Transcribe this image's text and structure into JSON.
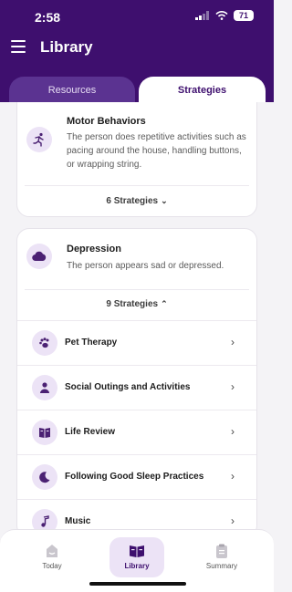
{
  "status_bar": {
    "time": "2:58",
    "battery": "71"
  },
  "header": {
    "title": "Library"
  },
  "tabs": [
    {
      "label": "Resources",
      "active": false
    },
    {
      "label": "Strategies",
      "active": true
    }
  ],
  "cards": {
    "motor": {
      "title": "Motor Behaviors",
      "description": "The person does repetitive activities such as pacing around the house, handling buttons, or wrapping string.",
      "strategies_label": "6 Strategies",
      "expanded": false
    },
    "depression": {
      "title": "Depression",
      "description": "The person appears sad or depressed.",
      "strategies_label": "9 Strategies",
      "expanded": true,
      "strategies": [
        {
          "label": "Pet Therapy",
          "icon": "paw-icon"
        },
        {
          "label": "Social Outings and Activities",
          "icon": "person-icon"
        },
        {
          "label": "Life Review",
          "icon": "book-icon"
        },
        {
          "label": "Following Good Sleep Practices",
          "icon": "moon-icon"
        },
        {
          "label": "Music",
          "icon": "music-note-icon"
        }
      ]
    }
  },
  "bottom_nav": [
    {
      "label": "Today",
      "active": false
    },
    {
      "label": "Library",
      "active": true
    },
    {
      "label": "Summary",
      "active": false
    }
  ],
  "colors": {
    "brand": "#3e0f6e",
    "accent_light": "#ece3f6",
    "icon_purple": "#4b2173"
  }
}
